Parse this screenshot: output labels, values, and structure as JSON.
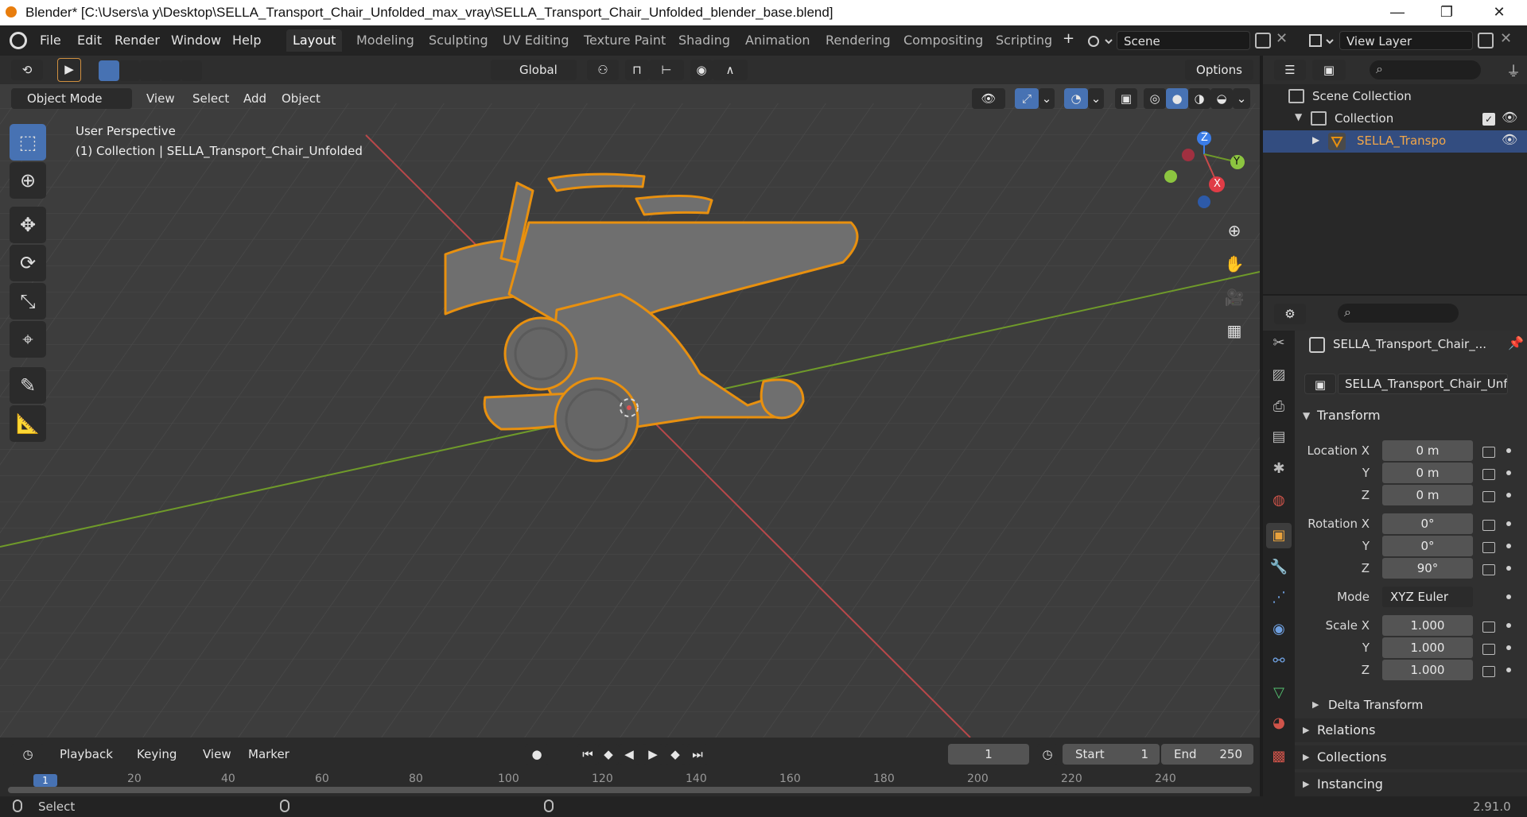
{
  "window": {
    "title": "Blender* [C:\\Users\\a y\\Desktop\\SELLA_Transport_Chair_Unfolded_max_vray\\SELLA_Transport_Chair_Unfolded_blender_base.blend]",
    "minimize": "—",
    "maximize": "❐",
    "close": "✕"
  },
  "menu": {
    "items": [
      "File",
      "Edit",
      "Render",
      "Window",
      "Help"
    ]
  },
  "workspaces": {
    "tabs": [
      "Layout",
      "Modeling",
      "Sculpting",
      "UV Editing",
      "Texture Paint",
      "Shading",
      "Animation",
      "Rendering",
      "Compositing",
      "Scripting"
    ],
    "active": "Layout",
    "add": "+"
  },
  "scene": {
    "label": "Scene"
  },
  "view_layer": {
    "label": "View Layer"
  },
  "tool_header": {
    "orientation": "Global",
    "options": "Options"
  },
  "viewport_header": {
    "mode": "Object Mode",
    "menus": [
      "View",
      "Select",
      "Add",
      "Object"
    ]
  },
  "viewport": {
    "perspective": "User Perspective",
    "collection_info": "(1) Collection | SELLA_Transport_Chair_Unfolded"
  },
  "gizmo": {
    "x": "X",
    "y": "Y",
    "z": "Z"
  },
  "outliner": {
    "scene_collection": "Scene Collection",
    "collection": "Collection",
    "object": "SELLA_Transport_Chai"
  },
  "properties": {
    "object_name": "SELLA_Transport_Chair_...",
    "data_name": "SELLA_Transport_Chair_Unf...",
    "transform": {
      "header": "Transform",
      "location_label": "Location X",
      "loc_x": "0 m",
      "loc_y": "0 m",
      "loc_z": "0 m",
      "rotation_label": "Rotation X",
      "rot_x": "0°",
      "rot_y": "0°",
      "rot_z": "90°",
      "mode_label": "Mode",
      "mode_value": "XYZ Euler",
      "scale_label": "Scale X",
      "scale_x": "1.000",
      "scale_y": "1.000",
      "scale_z": "1.000",
      "y": "Y",
      "z": "Z"
    },
    "panels": [
      "Delta Transform",
      "Relations",
      "Collections",
      "Instancing"
    ]
  },
  "timeline": {
    "menus": [
      "Playback",
      "Keying",
      "View",
      "Marker"
    ],
    "current_frame": "1",
    "start_label": "Start",
    "start": "1",
    "end_label": "End",
    "end": "250",
    "ruler": [
      "1",
      "20",
      "40",
      "60",
      "80",
      "100",
      "120",
      "140",
      "160",
      "180",
      "200",
      "220",
      "240"
    ]
  },
  "status": {
    "select": "Select",
    "version": "2.91.0"
  },
  "colors": {
    "accent": "#4772b3",
    "selection_outline": "#e8900f",
    "x_axis": "#c84a4a",
    "y_axis": "#6f9a2a",
    "z_axis": "#3b7de8",
    "gizmo_y": "#8cc540"
  }
}
